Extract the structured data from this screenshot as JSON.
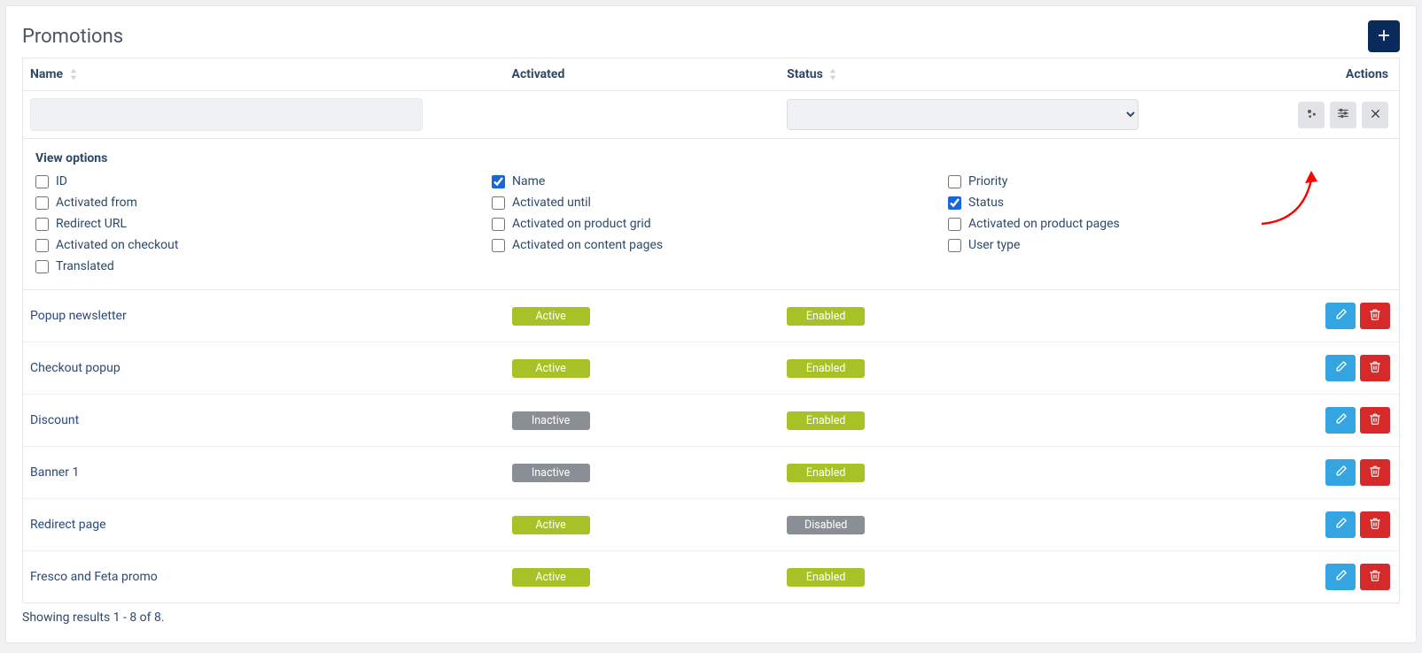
{
  "page": {
    "title": "Promotions"
  },
  "table": {
    "headers": {
      "name": "Name",
      "activated": "Activated",
      "status": "Status",
      "actions": "Actions"
    },
    "results_line": "Showing results 1 - 8 of 8."
  },
  "filters": {
    "name_value": "",
    "status_value": ""
  },
  "view_options": {
    "title": "View options",
    "items": [
      {
        "label": "ID",
        "checked": false
      },
      {
        "label": "Name",
        "checked": true
      },
      {
        "label": "Priority",
        "checked": false
      },
      {
        "label": "Activated from",
        "checked": false
      },
      {
        "label": "Activated until",
        "checked": false
      },
      {
        "label": "Status",
        "checked": true
      },
      {
        "label": "Redirect URL",
        "checked": false
      },
      {
        "label": "Activated on product grid",
        "checked": false
      },
      {
        "label": "Activated on product pages",
        "checked": false
      },
      {
        "label": "Activated on checkout",
        "checked": false
      },
      {
        "label": "Activated on content pages",
        "checked": false
      },
      {
        "label": "User type",
        "checked": false
      },
      {
        "label": "Translated",
        "checked": false
      }
    ]
  },
  "badges": {
    "active": {
      "text": "Active",
      "class": "badge-green"
    },
    "inactive": {
      "text": "Inactive",
      "class": "badge-grey"
    },
    "enabled": {
      "text": "Enabled",
      "class": "badge-green"
    },
    "disabled": {
      "text": "Disabled",
      "class": "badge-grey"
    }
  },
  "rows": [
    {
      "name": "Popup newsletter",
      "activated": "active",
      "status": "enabled"
    },
    {
      "name": "Checkout popup",
      "activated": "active",
      "status": "enabled"
    },
    {
      "name": "Discount",
      "activated": "inactive",
      "status": "enabled"
    },
    {
      "name": "Banner 1",
      "activated": "inactive",
      "status": "enabled"
    },
    {
      "name": "Redirect page",
      "activated": "active",
      "status": "disabled"
    },
    {
      "name": "Fresco and Feta promo",
      "activated": "active",
      "status": "enabled"
    }
  ],
  "icons": {
    "plus": "plus-icon",
    "sort": "sort-icon",
    "cogs": "cogs-icon",
    "sliders": "sliders-icon",
    "close": "close-icon",
    "edit": "edit-icon",
    "trash": "trash-icon"
  }
}
